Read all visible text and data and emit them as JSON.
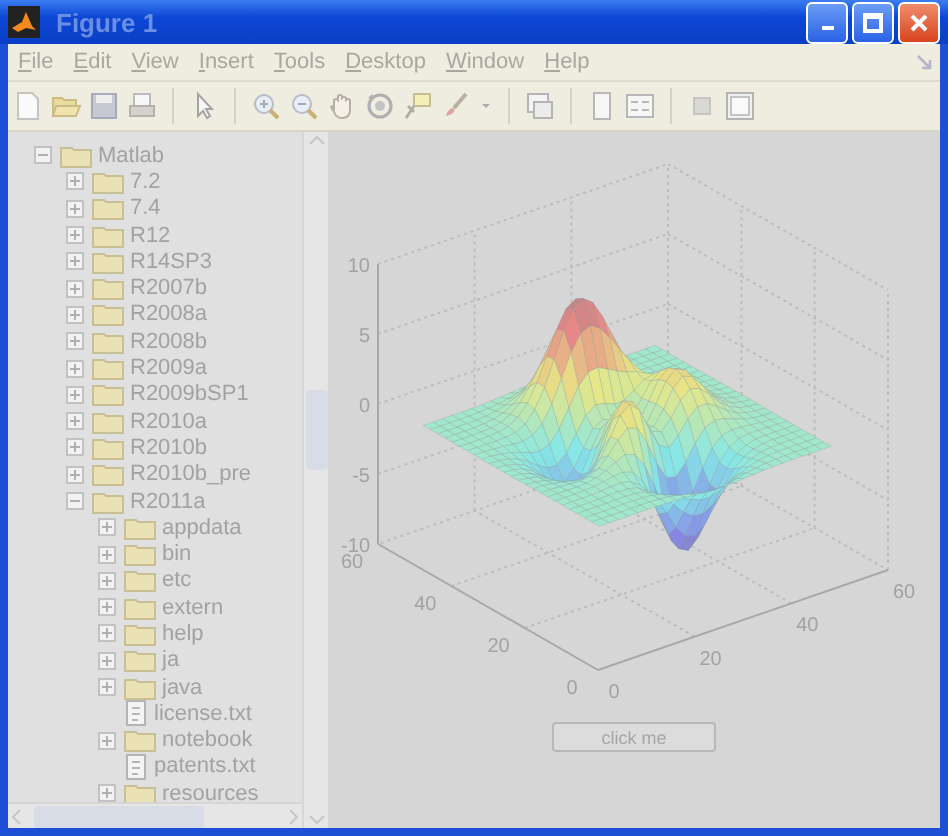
{
  "window": {
    "title": "Figure 1"
  },
  "menu": [
    "File",
    "Edit",
    "View",
    "Insert",
    "Tools",
    "Desktop",
    "Window",
    "Help"
  ],
  "tree": [
    {
      "label": "Matlab",
      "kind": "folder",
      "expanded": true,
      "children": [
        {
          "label": "7.2",
          "kind": "folder",
          "expanded": false
        },
        {
          "label": "7.4",
          "kind": "folder",
          "expanded": false
        },
        {
          "label": "R12",
          "kind": "folder",
          "expanded": false
        },
        {
          "label": "R14SP3",
          "kind": "folder",
          "expanded": false
        },
        {
          "label": "R2007b",
          "kind": "folder",
          "expanded": false
        },
        {
          "label": "R2008a",
          "kind": "folder",
          "expanded": false
        },
        {
          "label": "R2008b",
          "kind": "folder",
          "expanded": false
        },
        {
          "label": "R2009a",
          "kind": "folder",
          "expanded": false
        },
        {
          "label": "R2009bSP1",
          "kind": "folder",
          "expanded": false
        },
        {
          "label": "R2010a",
          "kind": "folder",
          "expanded": false
        },
        {
          "label": "R2010b",
          "kind": "folder",
          "expanded": false
        },
        {
          "label": "R2010b_pre",
          "kind": "folder",
          "expanded": false
        },
        {
          "label": "R2011a",
          "kind": "folder",
          "expanded": true,
          "children": [
            {
              "label": "appdata",
              "kind": "folder",
              "expanded": false
            },
            {
              "label": "bin",
              "kind": "folder",
              "expanded": false
            },
            {
              "label": "etc",
              "kind": "folder",
              "expanded": false
            },
            {
              "label": "extern",
              "kind": "folder",
              "expanded": false
            },
            {
              "label": "help",
              "kind": "folder",
              "expanded": false
            },
            {
              "label": "ja",
              "kind": "folder",
              "expanded": false
            },
            {
              "label": "java",
              "kind": "folder",
              "expanded": false
            },
            {
              "label": "license.txt",
              "kind": "file"
            },
            {
              "label": "notebook",
              "kind": "folder",
              "expanded": false
            },
            {
              "label": "patents.txt",
              "kind": "file"
            },
            {
              "label": "resources",
              "kind": "folder",
              "expanded": false
            }
          ]
        }
      ]
    }
  ],
  "plot": {
    "z_ticks": [
      "10",
      "5",
      "0",
      "-5",
      "-10"
    ],
    "y_ticks": [
      "60",
      "40",
      "20",
      "0"
    ],
    "x_ticks": [
      "0",
      "20",
      "40",
      "60"
    ]
  },
  "button": {
    "label": "click me"
  }
}
